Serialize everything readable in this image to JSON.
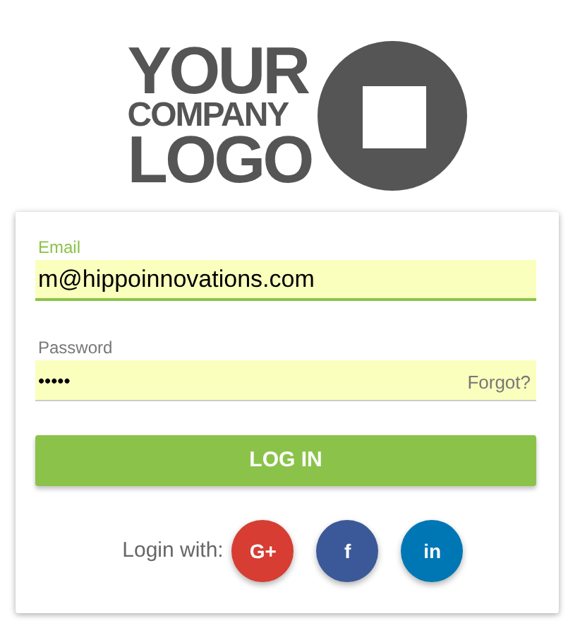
{
  "logo": {
    "lines": [
      "YOUR",
      "COMPANY",
      "LOGO"
    ]
  },
  "fields": [
    {
      "kind": "email",
      "label": "Email",
      "value": "m@hippoinnovations.com",
      "focused": true
    },
    {
      "kind": "password",
      "label": "Password",
      "value": "•••••",
      "focused": false,
      "link": "Forgot?"
    }
  ],
  "login_button": "LOG IN",
  "social": {
    "label": "Login with:",
    "buttons": [
      {
        "glyph": "G+",
        "color": "#d73d32"
      },
      {
        "glyph": "f",
        "color": "#3b5998"
      },
      {
        "glyph": "in",
        "color": "#0077b5"
      }
    ]
  }
}
